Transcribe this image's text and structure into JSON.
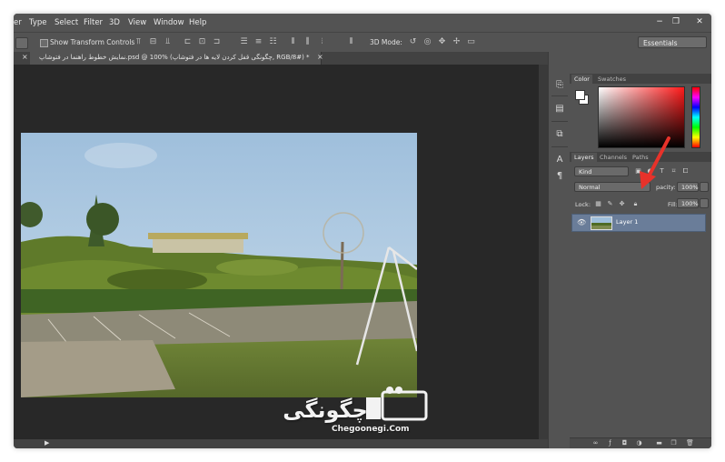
{
  "menubar": {
    "items": [
      "er",
      "Type",
      "Select",
      "Filter",
      "3D",
      "View",
      "Window",
      "Help"
    ],
    "minimize": "−",
    "restore": "❐",
    "close": "✕"
  },
  "options": {
    "show_transform_controls": "Show Transform Controls",
    "mode_3d": "3D Mode:",
    "workspace": "Essentials"
  },
  "document": {
    "prev_tab_close": "×",
    "tab_title": "نمایش خطوط راهنما در فتوشاپ.psd @ 100% (چگونگی قفل کردن لایه ها در فتوشاپ, RGB/8#) *",
    "tab_close": "×"
  },
  "watermark": {
    "arabic": "چگونگی",
    "latin": "Chegoonegi.Com"
  },
  "color_panel": {
    "tabs": [
      "Color",
      "Swatches"
    ],
    "colors": {
      "foreground": "#ffffff",
      "background": "#ffffff"
    }
  },
  "layers_panel": {
    "tabs": [
      "Layers",
      "Channels",
      "Paths"
    ],
    "filter_kind": "Kind",
    "blend_mode": "Normal",
    "opacity_label": "pacity:",
    "opacity_value": "100%",
    "lock_label": "Lock:",
    "fill_label": "Fill:",
    "fill_value": "100%",
    "layers": [
      {
        "name": "Layer 1",
        "visible": true,
        "selected": true
      }
    ]
  },
  "accent": {
    "selection": "#6a7d99",
    "annotation_arrow": "#e8322a"
  }
}
